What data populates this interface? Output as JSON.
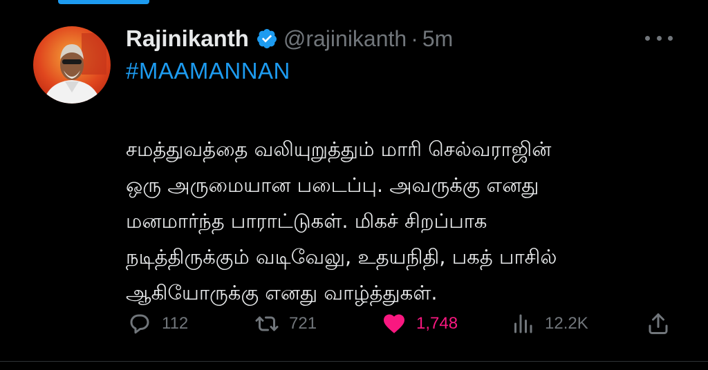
{
  "tweet": {
    "display_name": "Rajinikanth",
    "handle": "@rajinikanth",
    "separator": "·",
    "time": "5m",
    "hashtag": "#MAAMANNAN",
    "body_lines": [
      "சமத்துவத்தை வலியுறுத்தும் மாரி செல்வராஜின்",
      "ஒரு அருமையான படைப்பு. அவருக்கு  எனது",
      "மனமார்ந்த பாராட்டுகள். மிகச் சிறப்பாக",
      "நடித்திருக்கும் வடிவேலு, உதயநிதி, பகத் பாசில்",
      "ஆகியோருக்கு எனது வாழ்த்துகள்."
    ]
  },
  "actions": {
    "reply_count": "112",
    "retweet_count": "721",
    "like_count": "1,748",
    "views_count": "12.2K"
  },
  "icons": {
    "verified": "verified-badge-icon",
    "more": "more-options-icon",
    "reply": "reply-icon",
    "retweet": "retweet-icon",
    "like": "heart-icon",
    "views": "views-icon",
    "share": "share-icon"
  },
  "colors": {
    "background": "#000000",
    "accent": "#1d9bf0",
    "like": "#f91880",
    "muted": "#71767b",
    "text": "#e7e9ea"
  }
}
